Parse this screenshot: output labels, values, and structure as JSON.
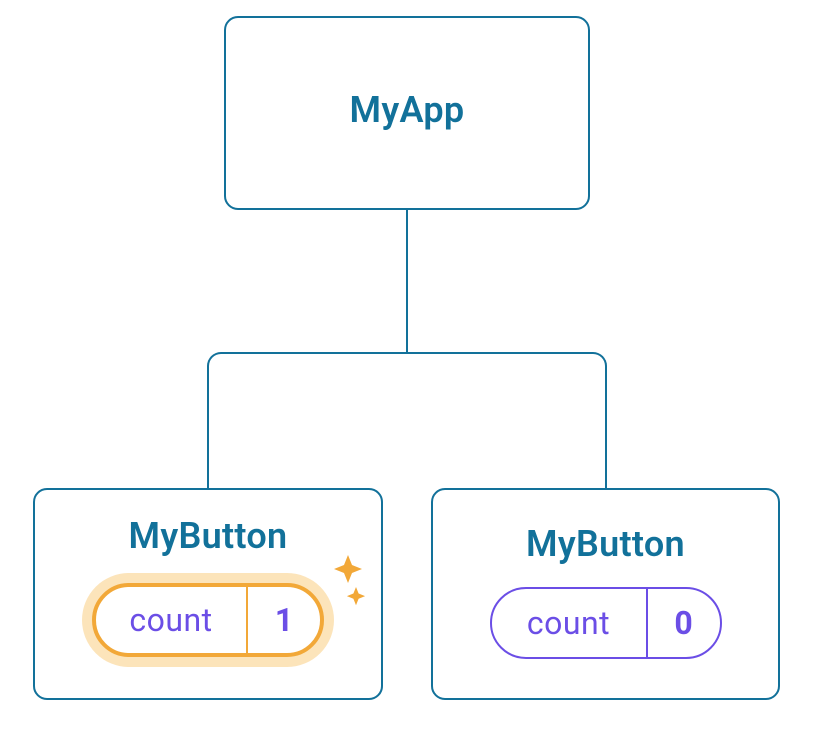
{
  "tree": {
    "root": {
      "label": "MyApp"
    },
    "left": {
      "label": "MyButton",
      "state_key": "count",
      "state_value": "1",
      "highlighted": true
    },
    "right": {
      "label": "MyButton",
      "state_key": "count",
      "state_value": "0",
      "highlighted": false
    }
  }
}
